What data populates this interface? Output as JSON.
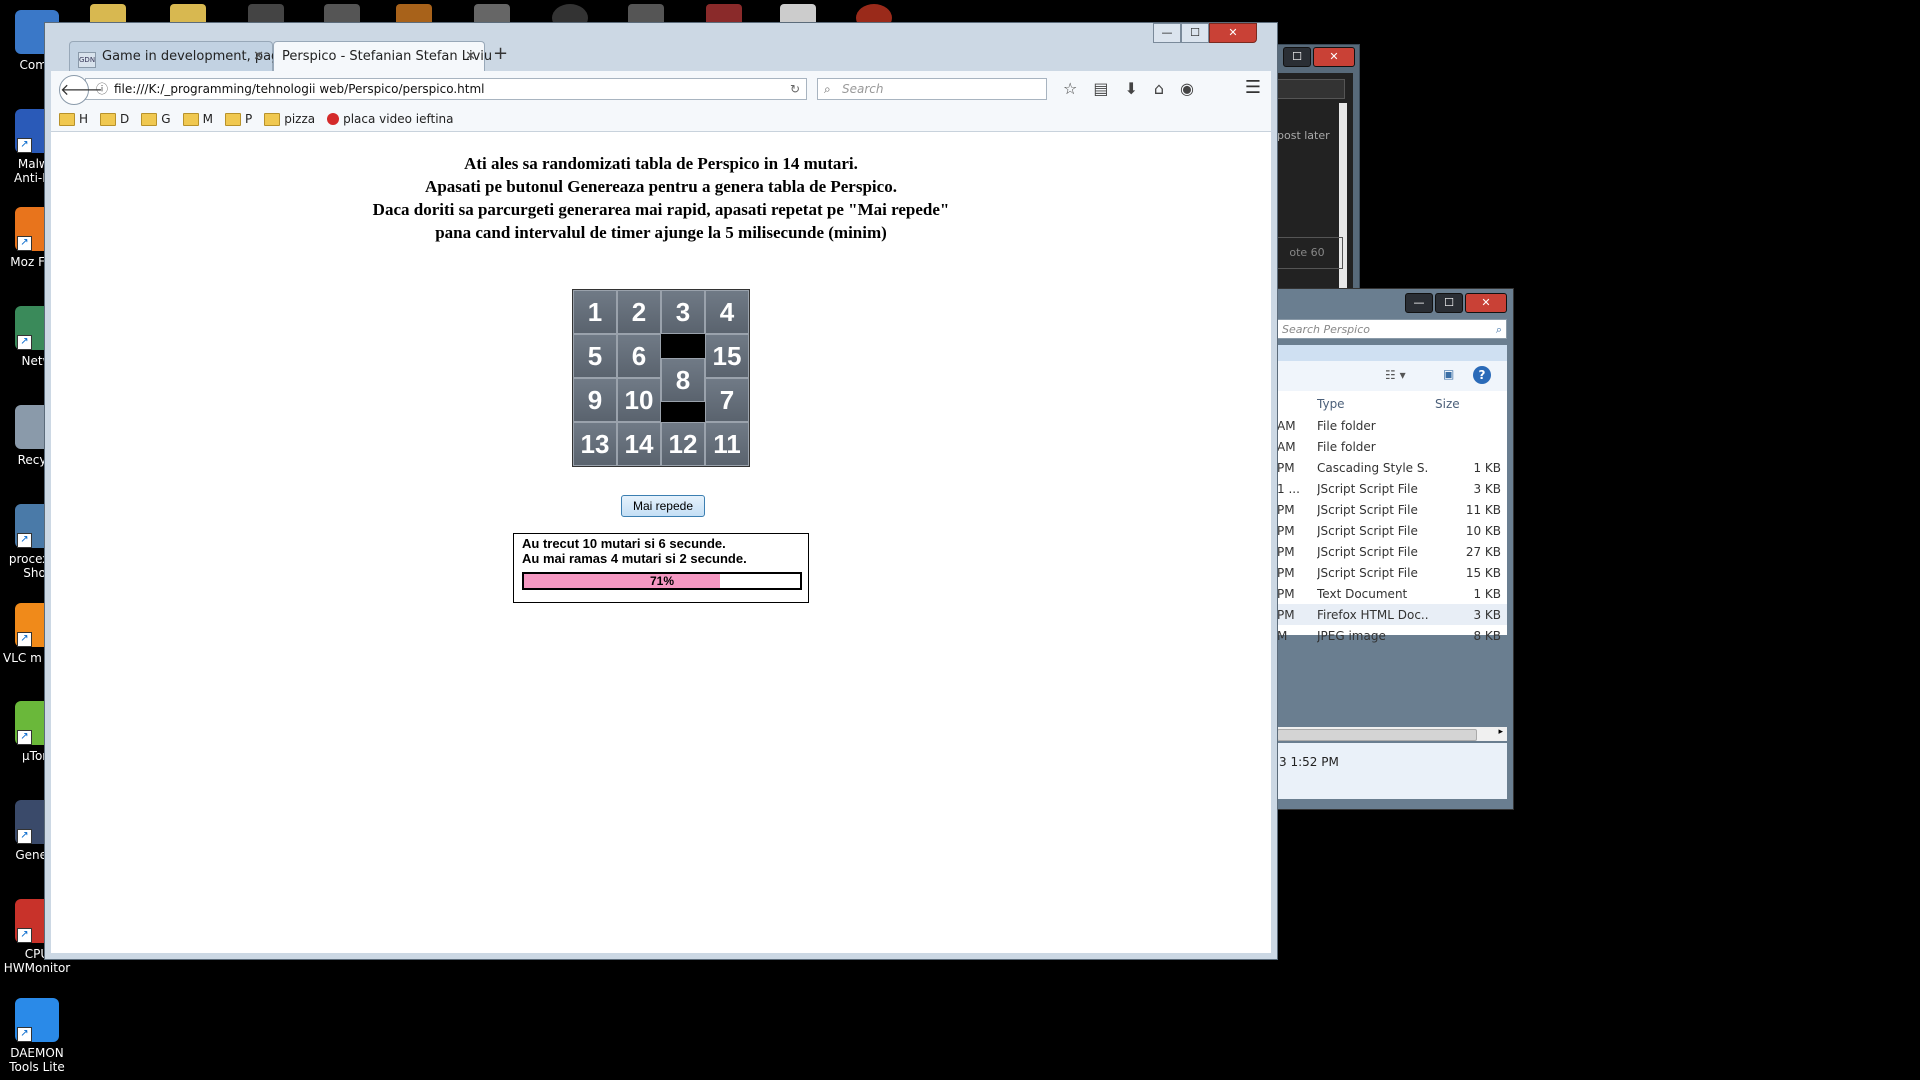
{
  "desktop": {
    "icons": [
      {
        "label": "Comp",
        "color": "#3a78c8"
      },
      {
        "label": "Malwa Anti-Ma",
        "color": "#2a5ab8"
      },
      {
        "label": "Moz Firef",
        "color": "#e8741c"
      },
      {
        "label": "Netw",
        "color": "#3a8a5a"
      },
      {
        "label": "Recycl",
        "color": "#8a9aaa"
      },
      {
        "label": "procexp - Shor",
        "color": "#4a7aa8"
      },
      {
        "label": "VLC m play",
        "color": "#f08a1a"
      },
      {
        "label": "µTorr",
        "color": "#6ab83a"
      },
      {
        "label": "Genefo",
        "color": "#3a4a6a"
      },
      {
        "label": "CPU HWMonitor",
        "color": "#c8322a"
      },
      {
        "label": "DAEMON Tools Lite",
        "color": "#2a8ae8"
      }
    ]
  },
  "explorer_back": {
    "text1": "post later",
    "text2": "ote 60"
  },
  "explorer": {
    "search_placeholder": "Search Perspico",
    "col_type": "Type",
    "col_size": "Size",
    "rows": [
      {
        "time": "AM",
        "type": "File folder",
        "size": ""
      },
      {
        "time": "AM",
        "type": "File folder",
        "size": ""
      },
      {
        "time": "PM",
        "type": "Cascading Style S...",
        "size": "1 KB"
      },
      {
        "time": "1 ...",
        "type": "JScript Script File",
        "size": "3 KB"
      },
      {
        "time": "PM",
        "type": "JScript Script File",
        "size": "11 KB"
      },
      {
        "time": "PM",
        "type": "JScript Script File",
        "size": "10 KB"
      },
      {
        "time": "PM",
        "type": "JScript Script File",
        "size": "27 KB"
      },
      {
        "time": "PM",
        "type": "JScript Script File",
        "size": "15 KB"
      },
      {
        "time": "PM",
        "type": "Text Document",
        "size": "1 KB"
      },
      {
        "time": "PM",
        "type": "Firefox HTML Doc...",
        "size": "3 KB"
      },
      {
        "time": "M",
        "type": "JPEG image",
        "size": "8 KB"
      }
    ],
    "status_text": "3 1:52 PM"
  },
  "browser": {
    "tabs": [
      {
        "title": "Game in development, pag..."
      },
      {
        "title": "Perspico - Stefanian Stefan Liviu"
      }
    ],
    "url": "file:///K:/_programming/tehnologii web/Perspico/perspico.html",
    "search_placeholder": "Search",
    "bookmarks": [
      "H",
      "D",
      "G",
      "M",
      "P",
      "pizza",
      "placa video ieftina"
    ]
  },
  "page": {
    "intro_lines": [
      "Ati ales sa randomizati tabla de Perspico in 14 mutari.",
      "Apasati pe butonul Genereaza pentru a genera tabla de Perspico.",
      "Daca doriti sa parcurgeti generarea mai rapid, apasati repetat pe \"Mai repede\"",
      "pana cand intervalul de timer ajunge la 5 milisecunde (minim)"
    ],
    "board": [
      [
        "1",
        "2",
        "3",
        "4"
      ],
      [
        "5",
        "6",
        "",
        "15"
      ],
      [
        "9",
        "10",
        "8",
        "7"
      ],
      [
        "13",
        "14",
        "12",
        "11"
      ]
    ],
    "sliding_tile": {
      "label": "8",
      "offset_fraction": 0.55
    },
    "speed_button": "Mai repede",
    "status_line1": "Au trecut 10 mutari si 6 secunde.",
    "status_line2": "Au mai ramas 4 mutari si 2 secunde.",
    "progress_percent": 71,
    "progress_label": "71%",
    "progress_color": "#f598c2"
  }
}
